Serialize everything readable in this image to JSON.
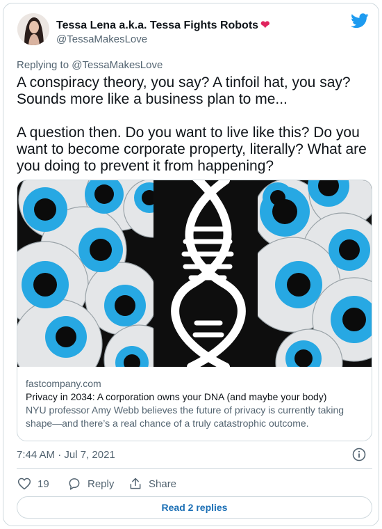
{
  "author": {
    "display_name": "Tessa Lena a.k.a. Tessa Fights Robots",
    "heart": "❤",
    "handle": "@TessaMakesLove"
  },
  "reply_context": "Replying to @TessaMakesLove",
  "tweet": {
    "text": "A conspiracy theory, you say? A tinfoil hat, you say? Sounds more like a business plan to me...\n\nA question then. Do you want to live like this? Do you want to become corporate property, literally? What are you doing to prevent it from happening?"
  },
  "link_card": {
    "domain": "fastcompany.com",
    "title": "Privacy in 2034: A corporation owns your DNA (and maybe your body)",
    "description": "NYU professor Amy Webb believes the future of privacy is currently taking shape—and there’s a real chance of a truly catastrophic outcome."
  },
  "timestamp": "7:44 AM · Jul 7, 2021",
  "actions": {
    "like_count": "19",
    "reply_label": "Reply",
    "share_label": "Share"
  },
  "read_replies_label": "Read 2 replies",
  "colors": {
    "twitter_blue": "#1d9bf0",
    "heart": "#e0245e",
    "eye_blue": "#27a8e3",
    "secondary_text": "#536471"
  }
}
